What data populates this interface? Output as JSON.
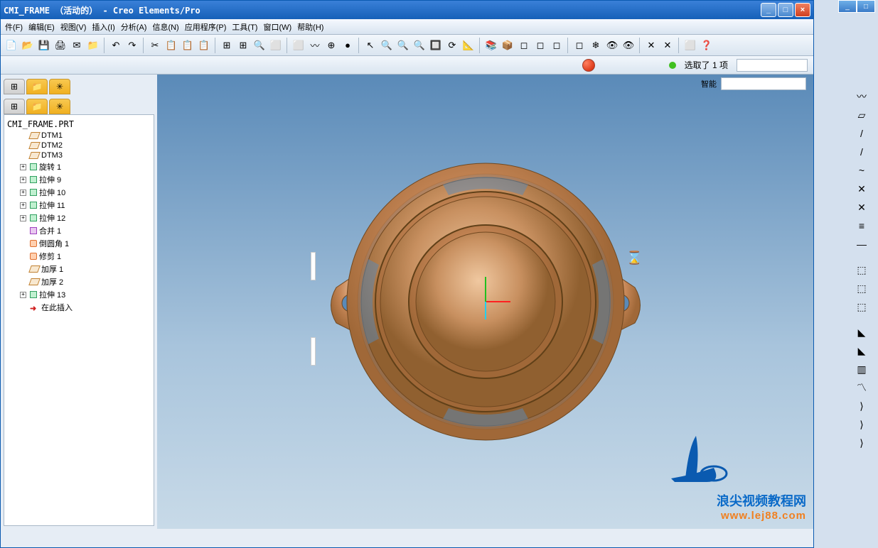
{
  "outer": {
    "min": "_",
    "max": "□",
    "close": "×"
  },
  "title": "CMI_FRAME （活动的） - Creo Elements/Pro",
  "winctl": {
    "min": "_",
    "max": "□",
    "close": "×"
  },
  "menu": [
    "件(F)",
    "编辑(E)",
    "视图(V)",
    "插入(I)",
    "分析(A)",
    "信息(N)",
    "应用程序(P)",
    "工具(T)",
    "窗口(W)",
    "帮助(H)"
  ],
  "status": {
    "selection": "选取了 1 项",
    "smart": "智能"
  },
  "tree": {
    "root": "CMI_FRAME.PRT",
    "items": [
      {
        "icon": "datum",
        "label": "DTM1"
      },
      {
        "icon": "datum",
        "label": "DTM2"
      },
      {
        "icon": "datum",
        "label": "DTM3"
      },
      {
        "icon": "feat",
        "label": "旋转 1",
        "exp": true
      },
      {
        "icon": "feat",
        "label": "拉伸 9",
        "exp": true
      },
      {
        "icon": "feat",
        "label": "拉伸 10",
        "exp": true
      },
      {
        "icon": "feat",
        "label": "拉伸 11",
        "exp": true
      },
      {
        "icon": "feat",
        "label": "拉伸 12",
        "exp": true
      },
      {
        "icon": "feat3",
        "label": "合并 1"
      },
      {
        "icon": "feat2",
        "label": "倒圆角 1"
      },
      {
        "icon": "feat2",
        "label": "修剪 1"
      },
      {
        "icon": "datum",
        "label": "加厚 1"
      },
      {
        "icon": "datum",
        "label": "加厚 2"
      },
      {
        "icon": "feat",
        "label": "拉伸 13",
        "exp": true
      },
      {
        "icon": "arrow",
        "label": "在此插入"
      }
    ]
  },
  "watermark": {
    "text1": "浪尖视频教程网",
    "text2": "www.lej88.com"
  },
  "toolbar_icons": [
    "📄",
    "📂",
    "💾",
    "🖨",
    "✉",
    "📁",
    "↶",
    "↷",
    "✂",
    "📋",
    "📋",
    "📋",
    "⊞",
    "⊞",
    "🔍",
    "⬜",
    "⬜",
    "〰",
    "⊕",
    "●",
    "↖",
    "🔍",
    "🔍",
    "🔍",
    "🔲",
    "⟳",
    "📐",
    "📚",
    "📦",
    "◻",
    "◻",
    "◻",
    "◻",
    "❄",
    "👁",
    "👁",
    "✕",
    "✕",
    "⬜",
    "❓"
  ],
  "right_icons": [
    "〰",
    "▱",
    "/",
    "/",
    "~",
    "✕",
    "✕",
    "≡",
    "—",
    "",
    "⬚",
    "⬚",
    "⬚",
    "",
    "◣",
    "◣",
    "▥",
    "〽",
    "⟩",
    "⟩",
    "⟩"
  ]
}
